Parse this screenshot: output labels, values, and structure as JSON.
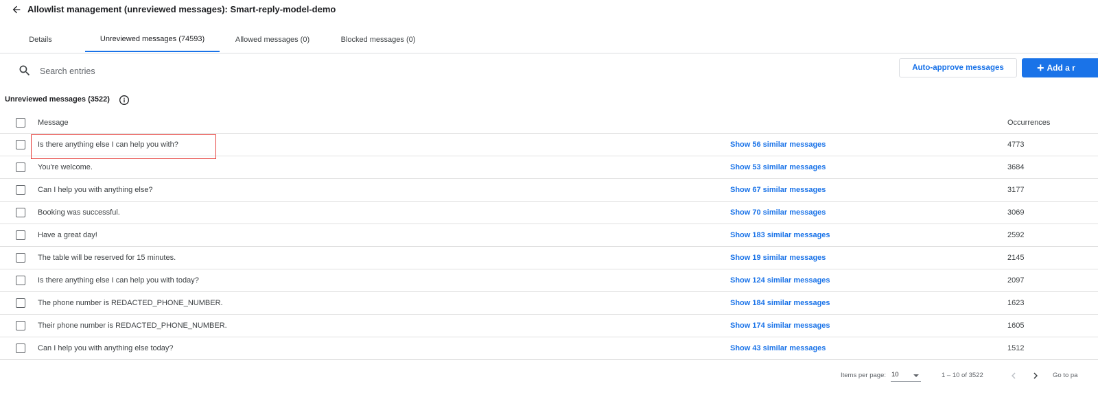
{
  "header": {
    "title": "Allowlist management (unreviewed messages): Smart-reply-model-demo"
  },
  "tabs": [
    {
      "label": "Details"
    },
    {
      "label": "Unreviewed messages (74593)"
    },
    {
      "label": "Allowed messages (0)"
    },
    {
      "label": "Blocked messages (0)"
    }
  ],
  "search": {
    "placeholder": "Search entries",
    "value": ""
  },
  "actions": {
    "auto_approve_label": "Auto-approve messages",
    "add_label": "Add a r"
  },
  "section": {
    "title": "Unreviewed messages (3522)"
  },
  "table": {
    "columns": {
      "message": "Message",
      "occurrences": "Occurrences"
    },
    "rows": [
      {
        "message": "Is there anything else I can help you with?",
        "similar": "Show 56 similar messages",
        "occurrences": "4773"
      },
      {
        "message": "You're welcome.",
        "similar": "Show 53 similar messages",
        "occurrences": "3684"
      },
      {
        "message": "Can I help you with anything else?",
        "similar": "Show 67 similar messages",
        "occurrences": "3177"
      },
      {
        "message": "Booking was successful.",
        "similar": "Show 70 similar messages",
        "occurrences": "3069"
      },
      {
        "message": "Have a great day!",
        "similar": "Show 183 similar messages",
        "occurrences": "2592"
      },
      {
        "message": "The table will be reserved for 15 minutes.",
        "similar": "Show 19 similar messages",
        "occurrences": "2145"
      },
      {
        "message": "Is there anything else I can help you with today?",
        "similar": "Show 124 similar messages",
        "occurrences": "2097"
      },
      {
        "message": "The phone number is REDACTED_PHONE_NUMBER.",
        "similar": "Show 184 similar messages",
        "occurrences": "1623"
      },
      {
        "message": "Their phone number is REDACTED_PHONE_NUMBER.",
        "similar": "Show 174 similar messages",
        "occurrences": "1605"
      },
      {
        "message": "Can I help you with anything else today?",
        "similar": "Show 43 similar messages",
        "occurrences": "1512"
      }
    ]
  },
  "pagination": {
    "items_per_page_label": "Items per page:",
    "items_per_page_value": "10",
    "range_label": "1 – 10 of 3522",
    "goto_label": "Go to pa"
  },
  "colors": {
    "accent": "#1a73e8",
    "highlight_border": "#e53935",
    "divider": "#e0e0e0"
  },
  "icons": {
    "back": "arrow-back-icon",
    "search": "search-icon",
    "info": "info-icon",
    "plus": "plus-icon",
    "prev": "chevron-left-icon",
    "next": "chevron-right-icon",
    "dropdown": "dropdown-arrow-icon"
  }
}
